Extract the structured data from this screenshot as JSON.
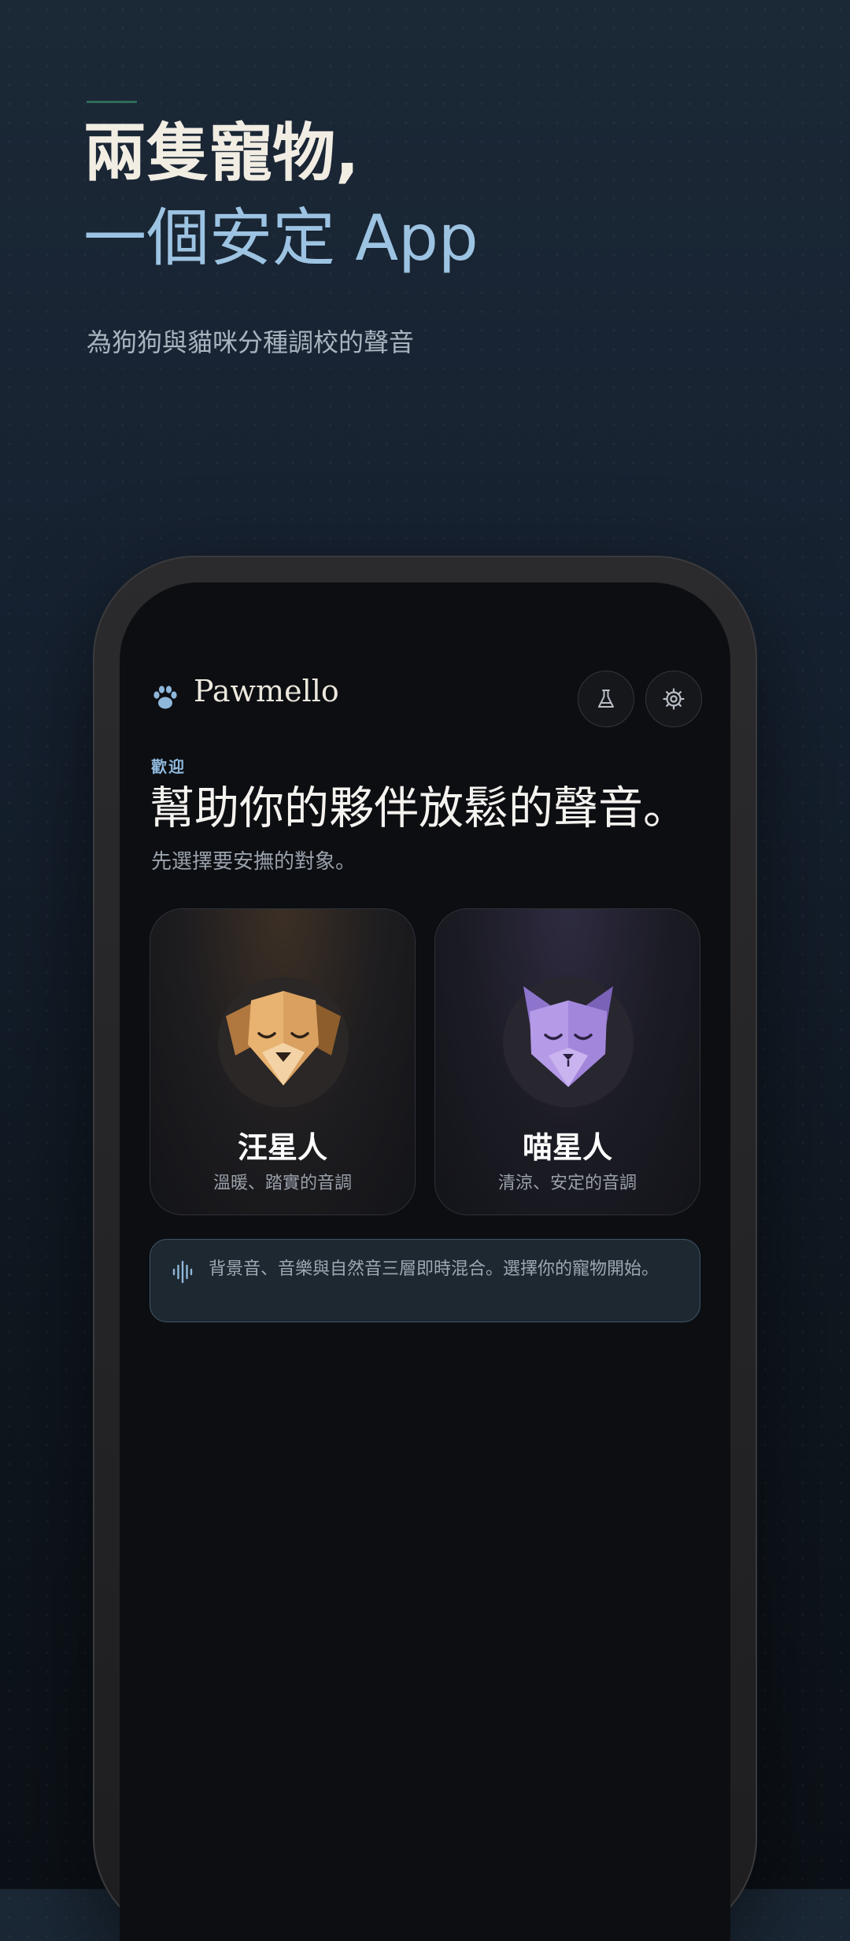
{
  "hero": {
    "title_line1": "兩隻寵物,",
    "title_line2": "一個安定 App",
    "subtitle": "為狗狗與貓咪分種調校的聲音"
  },
  "app": {
    "name": "Pawmello",
    "icons": {
      "logo": "paw-icon",
      "lab": "flask-icon",
      "settings": "gear-icon",
      "banner": "sound-wave-icon"
    },
    "eyebrow": "歡迎",
    "title": "幫助你的夥伴放鬆的聲音。",
    "subtitle": "先選擇要安撫的對象。",
    "pets": [
      {
        "name": "汪星人",
        "description": "溫暖、踏實的音調",
        "avatar": "sleeping-dog-icon"
      },
      {
        "name": "喵星人",
        "description": "清涼、安定的音調",
        "avatar": "sleeping-cat-icon"
      }
    ],
    "info": "背景音、音樂與自然音三層即時混合。選擇你的寵物開始。"
  },
  "colors": {
    "accent_blue": "#8fb7da",
    "dog_accent": "#e8b270",
    "cat_accent": "#b59ae8",
    "hero_title": "#f2ede3"
  }
}
